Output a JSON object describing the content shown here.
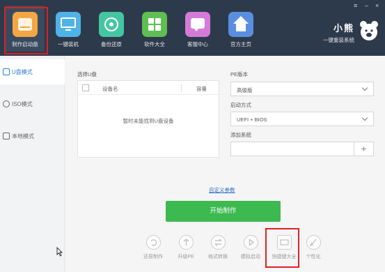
{
  "header": {
    "nav": [
      {
        "label": "制作启动盘",
        "icon": "usb-drive-icon",
        "color": "#f2a744",
        "active": true
      },
      {
        "label": "一键装机",
        "icon": "monitor-icon",
        "color": "#4fb3e8"
      },
      {
        "label": "备份还原",
        "icon": "restore-icon",
        "color": "#45c6a3"
      },
      {
        "label": "软件大全",
        "icon": "apps-grid-icon",
        "color": "#5fbf52"
      },
      {
        "label": "客服中心",
        "icon": "chat-icon",
        "color": "#d57ad8"
      },
      {
        "label": "官方主页",
        "icon": "home-icon",
        "color": "#5a8fe0"
      }
    ],
    "brand_title": "小熊",
    "brand_subtitle": "一键重装系统",
    "window_controls": {
      "menu": "≡",
      "minimize": "–",
      "close": "×"
    }
  },
  "sidebar": {
    "items": [
      {
        "label": "U盘模式",
        "icon": "usb-mode-icon",
        "active": true
      },
      {
        "label": "ISO模式",
        "icon": "disc-icon"
      },
      {
        "label": "本地模式",
        "icon": "local-drive-icon"
      }
    ]
  },
  "main": {
    "select_usb_label": "选择U盘",
    "device_col": "设备名",
    "capacity_col": "容量",
    "empty_text": "暂时未能找到U盘设备",
    "pe_version_label": "PE版本",
    "pe_version_value": "高级版",
    "boot_mode_label": "启动方式",
    "boot_mode_value": "UEFI + BIOS",
    "add_system_label": "添加系统",
    "add_system_button": "+",
    "custom_params_link": "自定义参数",
    "start_button": "开始制作",
    "tools": [
      {
        "label": "还原制作",
        "icon": "undo-icon"
      },
      {
        "label": "升级PE",
        "icon": "upgrade-icon"
      },
      {
        "label": "格式转换",
        "icon": "convert-icon"
      },
      {
        "label": "模拟启动",
        "icon": "play-icon"
      },
      {
        "label": "快捷键大全",
        "icon": "keyboard-icon"
      },
      {
        "label": "个性化",
        "icon": "brush-icon"
      }
    ]
  },
  "colors": {
    "header_bg": "#2d3a4b",
    "accent_green": "#3cb94f",
    "highlight_red": "#e02020",
    "link_blue": "#2b6cc4"
  }
}
